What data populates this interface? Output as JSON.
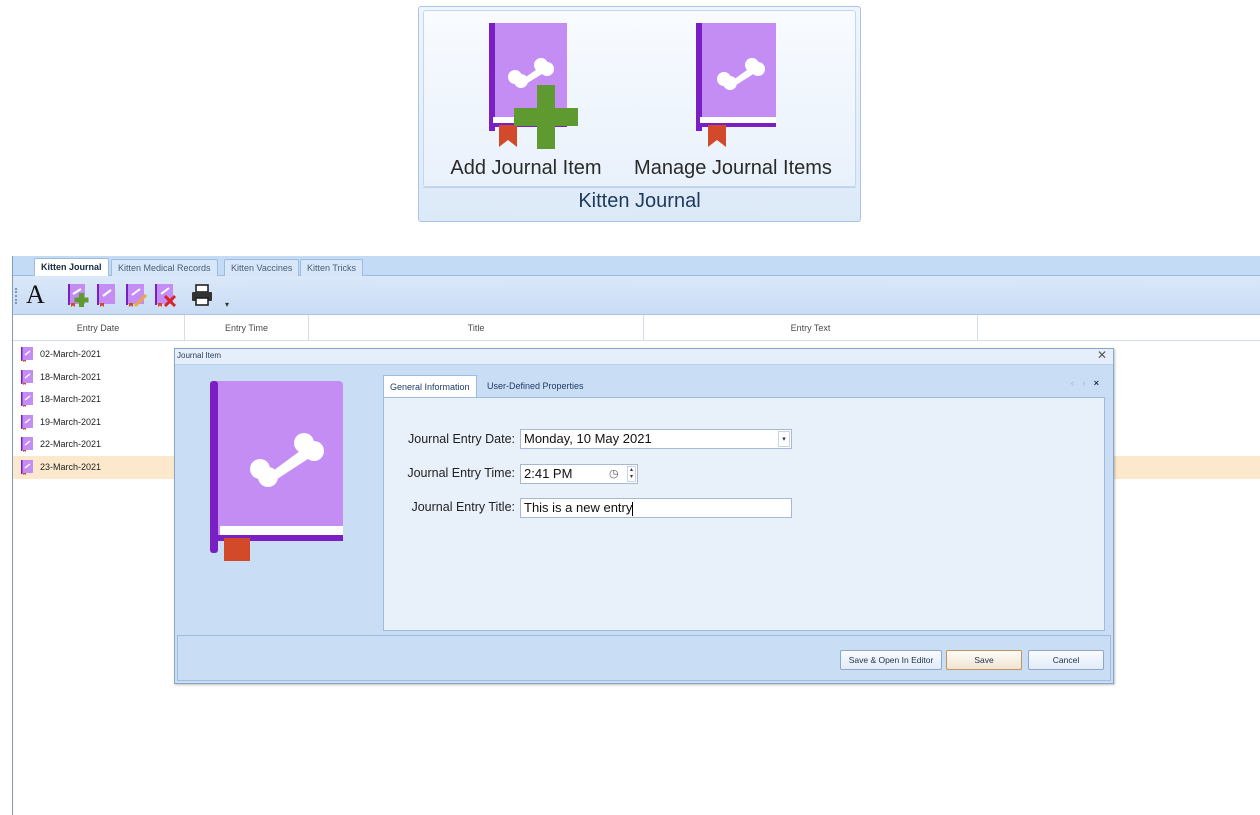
{
  "ribbon": {
    "add_label": "Add Journal Item",
    "manage_label": "Manage Journal Items",
    "group_caption": "Kitten Journal"
  },
  "tabs": [
    {
      "label": "Kitten Journal",
      "active": true
    },
    {
      "label": "Kitten Medical Records"
    },
    {
      "label": "Kitten Vaccines"
    },
    {
      "label": "Kitten Tricks"
    }
  ],
  "toolbar": {
    "font_glyph": "A"
  },
  "grid": {
    "columns": [
      "Entry Date",
      "Entry Time",
      "Title",
      "Entry Text"
    ],
    "rows": [
      {
        "date": "02-March-2021"
      },
      {
        "date": "18-March-2021"
      },
      {
        "date": "18-March-2021"
      },
      {
        "date": "19-March-2021"
      },
      {
        "date": "22-March-2021"
      },
      {
        "date": "23-March-2021",
        "selected": true
      }
    ]
  },
  "dialog": {
    "title": "Journal Item",
    "close_glyph": "✕",
    "tabs": [
      "General Information",
      "User-Defined Properties"
    ],
    "tab_close_glyph": "×",
    "fields": {
      "date_label": "Journal Entry Date:",
      "date_value": "Monday, 10 May 2021",
      "time_label": "Journal Entry Time:",
      "time_value": "2:41 PM",
      "title_label": "Journal Entry Title:",
      "title_value": "This is a new entry"
    },
    "buttons": {
      "save_open": "Save & Open In Editor",
      "save": "Save",
      "cancel": "Cancel"
    }
  },
  "colors": {
    "book": "#c48df3",
    "book_spine": "#7a1fc4",
    "bookmark": "#d24a2a",
    "plus": "#5f9a30",
    "ribbon_border": "#a9c4e6",
    "tab_bar": "#c4dbf6",
    "selection": "#fbe8cd"
  },
  "icons": [
    "journal-book-icon",
    "add-plus-icon",
    "edit-pencil-icon",
    "delete-x-icon",
    "printer-icon",
    "clock-icon",
    "dropdown-arrow-icon",
    "spin-arrows-icon"
  ]
}
